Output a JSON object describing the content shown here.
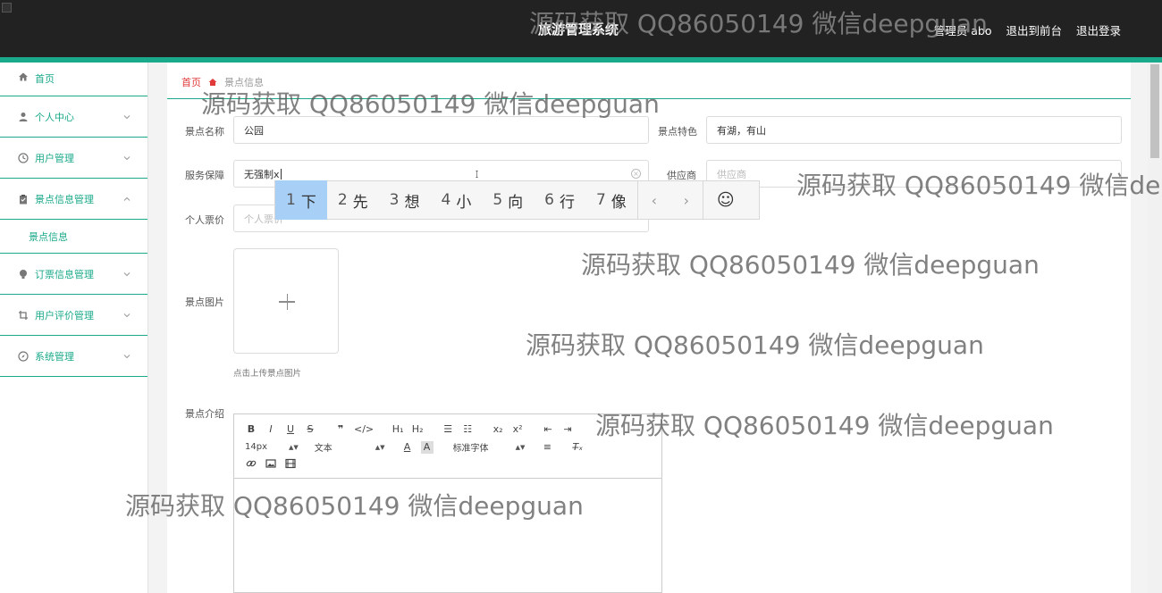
{
  "header": {
    "title": "旅游管理系统",
    "admin_label": "管理员 abo",
    "to_front_label": "退出到前台",
    "logout_label": "退出登录"
  },
  "sidebar": {
    "items": [
      {
        "label": "首页",
        "icon": "home-icon"
      },
      {
        "label": "个人中心",
        "icon": "user-icon"
      },
      {
        "label": "用户管理",
        "icon": "clock-icon"
      },
      {
        "label": "景点信息管理",
        "icon": "clipboard-icon"
      },
      {
        "label": "订票信息管理",
        "icon": "bulb-icon"
      },
      {
        "label": "用户评价管理",
        "icon": "crop-icon"
      },
      {
        "label": "系统管理",
        "icon": "compass-icon"
      }
    ],
    "sub_item": "景点信息"
  },
  "breadcrumb": {
    "home": "首页",
    "current": "景点信息"
  },
  "form": {
    "name_label": "景点名称",
    "name_value": "公园",
    "feature_label": "景点特色",
    "feature_value": "有湖，有山",
    "service_label": "服务保障",
    "service_value": "无强制x",
    "supplier_label": "供应商",
    "supplier_placeholder": "供应商",
    "price_label": "个人票价",
    "price_placeholder": "个人票价",
    "image_label": "景点图片",
    "upload_hint": "点击上传景点图片",
    "intro_label": "景点介绍"
  },
  "editor": {
    "font_size": "14px",
    "block_type": "文本",
    "font_family": "标准字体"
  },
  "ime": {
    "candidates": [
      {
        "num": "1",
        "char": "下"
      },
      {
        "num": "2",
        "char": "先"
      },
      {
        "num": "3",
        "char": "想"
      },
      {
        "num": "4",
        "char": "小"
      },
      {
        "num": "5",
        "char": "向"
      },
      {
        "num": "6",
        "char": "行"
      },
      {
        "num": "7",
        "char": "像"
      }
    ],
    "prev": "‹",
    "next": "›",
    "emoji": "☺"
  },
  "watermark": {
    "text": "源码获取 QQ86050149 微信deepguan"
  },
  "colors": {
    "accent": "#1aa98a",
    "header_bg": "#222222",
    "breadcrumb_home": "#e03a3a",
    "ime_highlight": "#a8d0f7"
  }
}
